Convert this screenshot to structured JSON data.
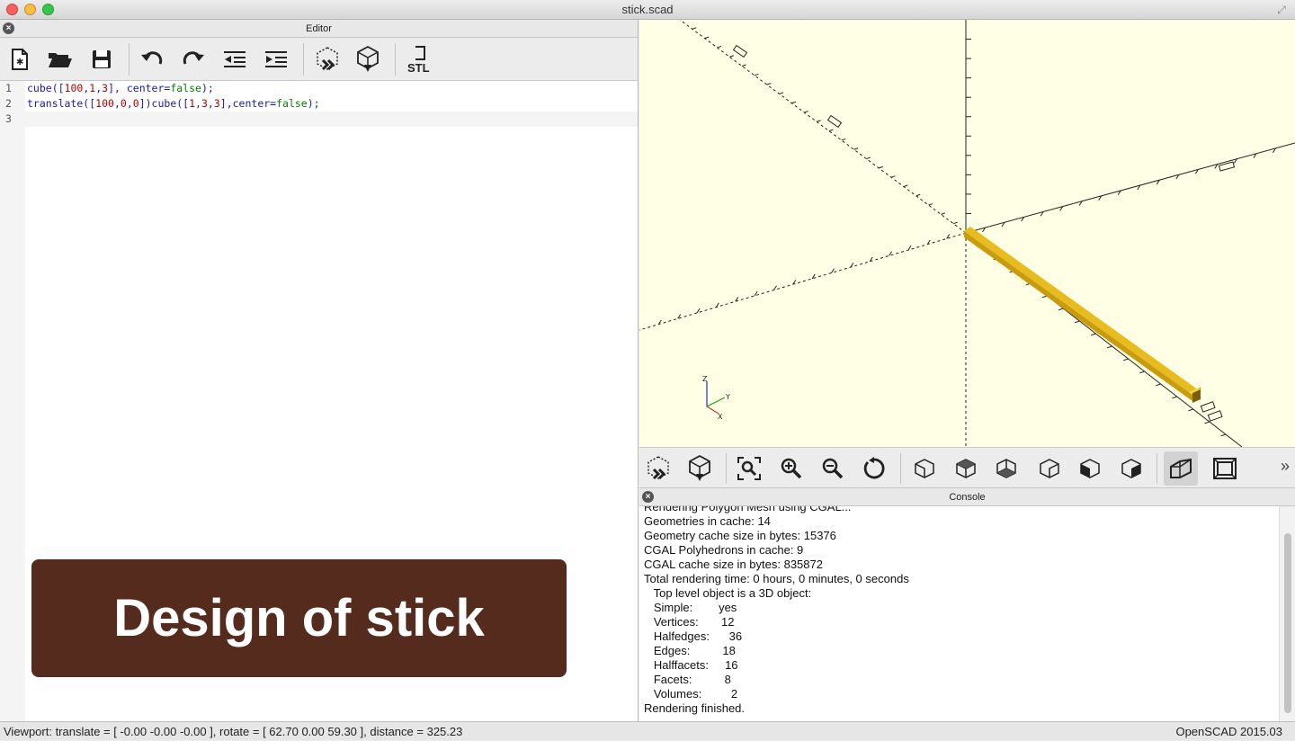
{
  "window": {
    "title": "stick.scad"
  },
  "editor": {
    "header": "Editor",
    "close_glyph": "×",
    "toolbar": [
      {
        "name": "new-file-button",
        "icon": "new-file-icon"
      },
      {
        "name": "open-file-button",
        "icon": "folder-open-icon"
      },
      {
        "name": "save-button",
        "icon": "floppy-disk-icon"
      },
      {
        "name": "undo-button",
        "icon": "undo-icon"
      },
      {
        "name": "redo-button",
        "icon": "redo-icon"
      },
      {
        "name": "unindent-button",
        "icon": "unindent-icon"
      },
      {
        "name": "indent-button",
        "icon": "indent-icon"
      },
      {
        "name": "preview-button",
        "icon": "preview-icon"
      },
      {
        "name": "render-button",
        "icon": "render-icon"
      },
      {
        "name": "export-stl-button",
        "icon": "stl-icon",
        "label": "STL"
      }
    ],
    "lines": [
      {
        "num": "1",
        "text": "cube([100,1,3], center=false);"
      },
      {
        "num": "2",
        "text": "translate([100,0,0])cube([1,3,3],center=false);"
      },
      {
        "num": "3",
        "text": ""
      }
    ]
  },
  "overlay": {
    "text": "Design of stick"
  },
  "viewport": {
    "axes_labels": {
      "z": "Z",
      "y": "Y",
      "x": "X"
    },
    "model_color": "#f2c626",
    "background": "#ffffe5"
  },
  "view_toolbar": {
    "buttons": [
      {
        "name": "view-preview-button",
        "icon": "preview-icon"
      },
      {
        "name": "view-render-button",
        "icon": "render-icon"
      },
      {
        "name": "view-all-button",
        "icon": "zoom-fit-icon"
      },
      {
        "name": "zoom-in-button",
        "icon": "zoom-in-icon"
      },
      {
        "name": "zoom-out-button",
        "icon": "zoom-out-icon"
      },
      {
        "name": "reset-view-button",
        "icon": "reset-view-icon"
      },
      {
        "name": "view-right-button",
        "icon": "cube-right-icon"
      },
      {
        "name": "view-top-button",
        "icon": "cube-top-icon"
      },
      {
        "name": "view-bottom-button",
        "icon": "cube-bottom-icon"
      },
      {
        "name": "view-left-button",
        "icon": "cube-left-icon"
      },
      {
        "name": "view-front-button",
        "icon": "cube-front-icon"
      },
      {
        "name": "view-back-button",
        "icon": "cube-back-icon"
      },
      {
        "name": "perspective-button",
        "icon": "perspective-icon"
      },
      {
        "name": "orthogonal-button",
        "icon": "orthogonal-icon"
      }
    ],
    "more": "»"
  },
  "console": {
    "header": "Console",
    "lines": [
      "Rendering Polygon Mesh using CGAL...",
      "Geometries in cache: 14",
      "Geometry cache size in bytes: 15376",
      "CGAL Polyhedrons in cache: 9",
      "CGAL cache size in bytes: 835872",
      "Total rendering time: 0 hours, 0 minutes, 0 seconds",
      "   Top level object is a 3D object:",
      "   Simple:        yes",
      "   Vertices:       12",
      "   Halfedges:      36",
      "   Edges:          18",
      "   Halffacets:     16",
      "   Facets:          8",
      "   Volumes:         2",
      "Rendering finished."
    ]
  },
  "status": {
    "viewport": "Viewport: translate = [ -0.00 -0.00 -0.00 ], rotate = [ 62.70 0.00 59.30 ], distance = 325.23",
    "version": "OpenSCAD 2015.03"
  }
}
